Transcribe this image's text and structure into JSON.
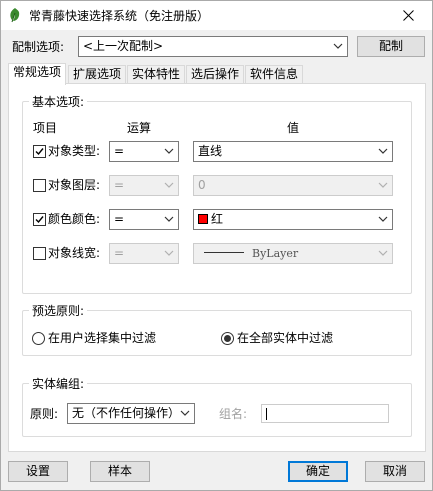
{
  "window": {
    "title": "常青藤快速选择系统（免注册版）",
    "close_label": "✕"
  },
  "config": {
    "label": "配制选项:",
    "selected": "<上一次配制>",
    "button_label": "配制"
  },
  "tabs": [
    {
      "label": "常规选项",
      "active": true
    },
    {
      "label": "扩展选项",
      "active": false
    },
    {
      "label": "实体特性",
      "active": false
    },
    {
      "label": "选后操作",
      "active": false
    },
    {
      "label": "软件信息",
      "active": false
    }
  ],
  "basic_options": {
    "title": "基本选项:",
    "headers": {
      "item": "项目",
      "operation": "运算",
      "value": "值"
    },
    "rows": [
      {
        "label": "对象类型:",
        "checked": true,
        "operator": "=",
        "value": "直线",
        "enabled": true
      },
      {
        "label": "对象图层:",
        "checked": false,
        "operator": "=",
        "value": "0",
        "enabled": false
      },
      {
        "label": "颜色颜色:",
        "checked": true,
        "operator": "=",
        "value": "红",
        "enabled": true,
        "swatch_color": "#ff0000"
      },
      {
        "label": "对象线宽:",
        "checked": false,
        "operator": "=",
        "value": "ByLayer",
        "enabled": false
      }
    ]
  },
  "preselect": {
    "title": "预选原则:",
    "option1": "在用户选择集中过滤",
    "option2": "在全部实体中过滤",
    "selected": 2
  },
  "entity_group": {
    "title": "实体编组:",
    "principle_label": "原则:",
    "principle_value": "无（不作任何操作）",
    "group_name_label": "组名:",
    "group_name_value": ""
  },
  "footer": {
    "settings": "设置",
    "sample": "样本",
    "ok": "确定",
    "cancel": "取消"
  },
  "colors": {
    "accent": "#0078d7",
    "icon_green": "#3a8a2e"
  }
}
